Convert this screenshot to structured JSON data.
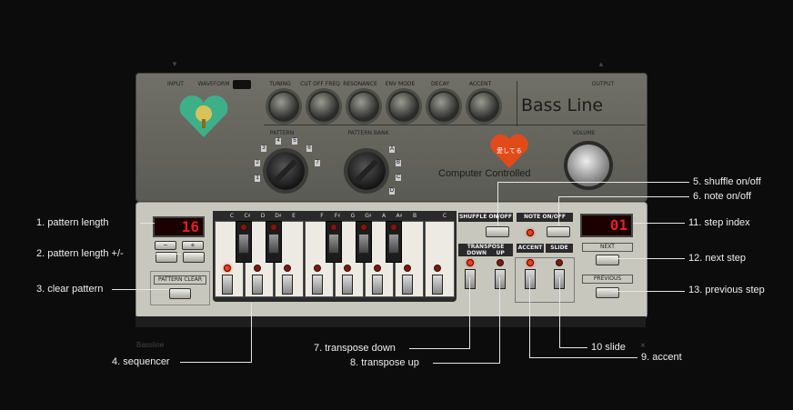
{
  "app": {
    "title": "Bass Line",
    "subtitle": "Computer Controlled",
    "plugin_name": "Bassline",
    "badge_text": "愛してる"
  },
  "top_panel": {
    "input_label": "INPUT",
    "output_label": "OUTPUT",
    "waveform_label": "WAVEFORM",
    "knobs": [
      {
        "label": "TUNING"
      },
      {
        "label": "CUT OFF FREQ"
      },
      {
        "label": "RESONANCE"
      },
      {
        "label": "ENV MODE"
      },
      {
        "label": "DECAY"
      },
      {
        "label": "ACCENT"
      }
    ],
    "pattern_label": "PATTERN",
    "pattern_bank_label": "PATTERN BANK",
    "volume_label": "VOLUME",
    "pattern_numbers": [
      "1",
      "2",
      "3",
      "4",
      "5",
      "6",
      "7"
    ],
    "bank_letters": [
      "A",
      "B",
      "C",
      "D"
    ]
  },
  "left_controls": {
    "lcd_value": "16",
    "minus_label": "−",
    "plus_label": "+",
    "pattern_clear_label": "PATTERN CLEAR"
  },
  "keyboard": {
    "white_notes": [
      "C",
      "D",
      "E",
      "F",
      "G",
      "A",
      "B",
      "C"
    ],
    "black_notes": [
      "C♯",
      "D♯",
      "F♯",
      "G♯",
      "A♯"
    ],
    "shuffle_label": "SHUFFLE ON/OFF",
    "note_label": "NOTE ON/OFF",
    "transpose_label": "TRANSPOSE",
    "down_label": "DOWN",
    "up_label": "UP",
    "accent_label": "ACCENT",
    "slide_label": "SLIDE"
  },
  "right_controls": {
    "lcd_value": "01",
    "next_label": "NEXT",
    "previous_label": "PREVIOUS"
  },
  "annotations": {
    "a1": "1. pattern length",
    "a2": "2. pattern length +/-",
    "a3": "3. clear pattern",
    "a4": "4. sequencer",
    "a5": "5. shuffle on/off",
    "a6": "6. note on/off",
    "a7": "7. transpose down",
    "a8": "8. transpose up",
    "a9": "9. accent",
    "a10": "10 slide",
    "a11": "11. step index",
    "a12": "12. next step",
    "a13": "13. previous step"
  },
  "colors": {
    "lcd_red": "#e02020",
    "led_on": "#ff3a18",
    "logo_green": "#3db08a",
    "badge_orange": "#e24a1a"
  },
  "close_glyph": "×"
}
